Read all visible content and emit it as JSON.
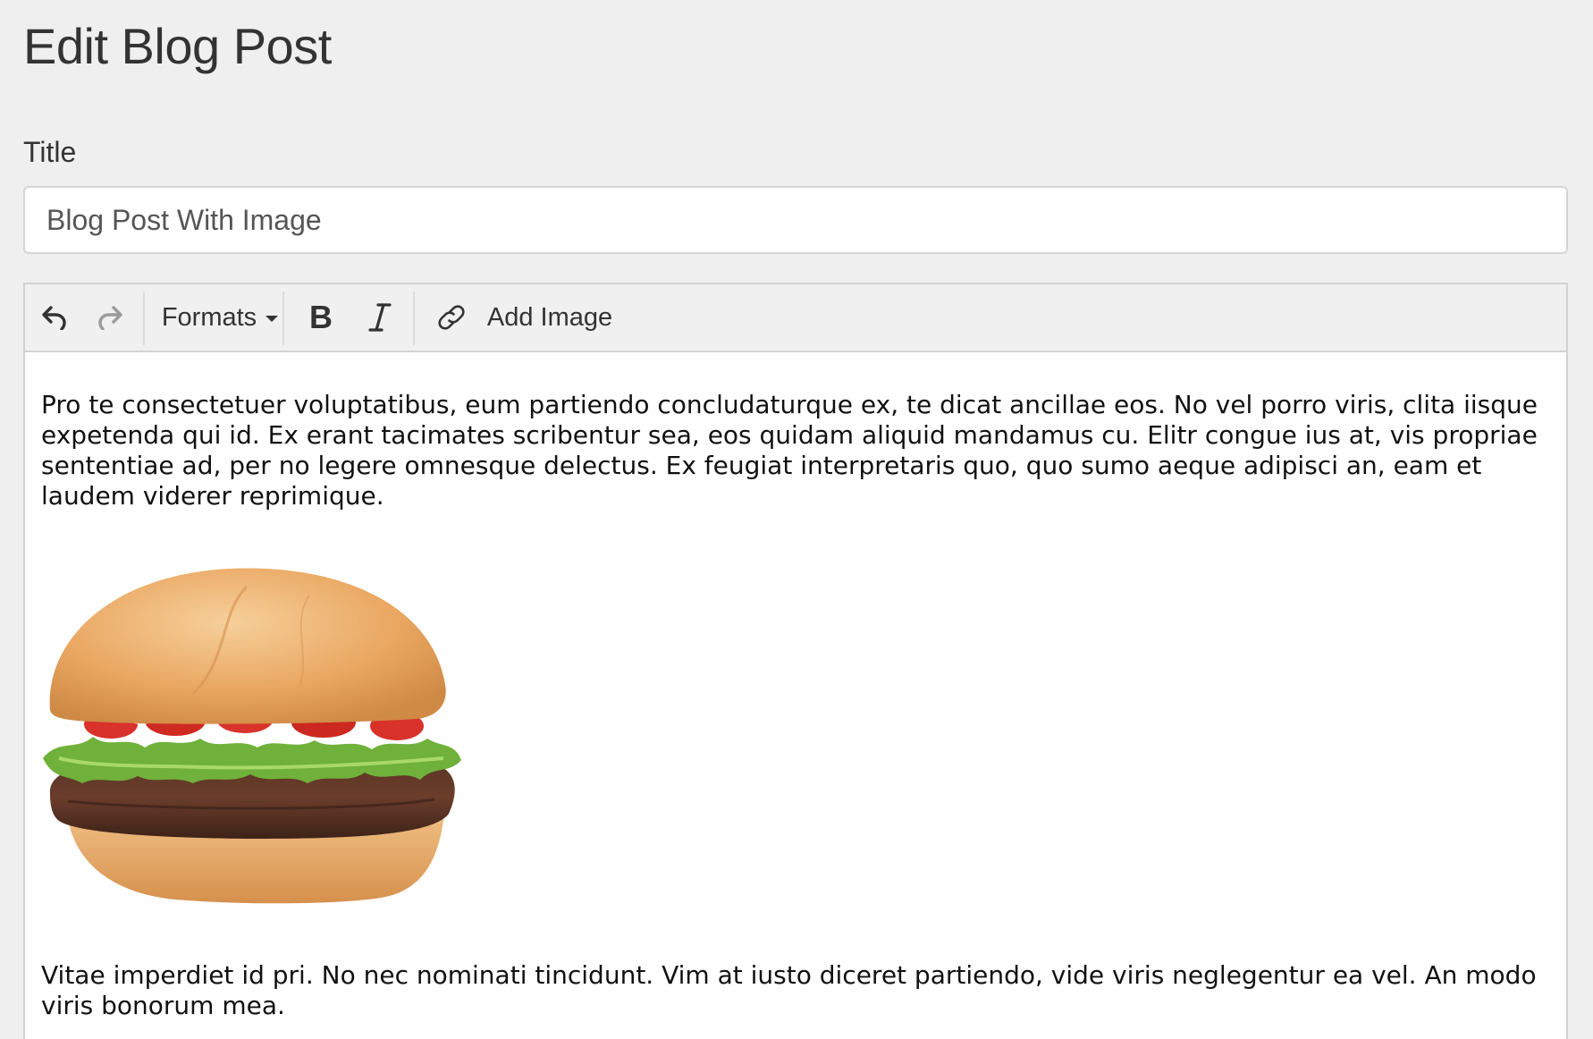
{
  "page": {
    "title": "Edit Blog Post"
  },
  "form": {
    "title_label": "Title",
    "title_value": "Blog Post With Image"
  },
  "toolbar": {
    "undo_icon": "undo-icon",
    "redo_icon": "redo-icon",
    "formats_label": "Formats",
    "bold_label": "B",
    "italic_label": "I",
    "link_icon": "link-icon",
    "add_image_label": "Add Image"
  },
  "content": {
    "paragraph_1": "Pro te consectetuer voluptatibus, eum partiendo concludaturque ex, te dicat ancillae eos. No vel porro viris, clita iisque expetenda qui id. Ex erant tacimates scribentur sea, eos quidam aliquid mandamus cu. Elitr congue ius at, vis propriae sententiae ad, per no legere omnesque delectus. Ex feugiat interpretaris quo, quo sumo aeque adipisci an, eam et laudem viderer reprimique.",
    "image": "hamburger-image",
    "paragraph_2": "Vitae imperdiet id pri. No nec nominati tincidunt. Vim at iusto diceret partiendo, vide viris neglegentur ea vel. An modo viris bonorum mea."
  },
  "colors": {
    "background": "#efefef",
    "toolbar": "#f0f0f0",
    "border": "#d3d3d3",
    "text": "#333333"
  }
}
